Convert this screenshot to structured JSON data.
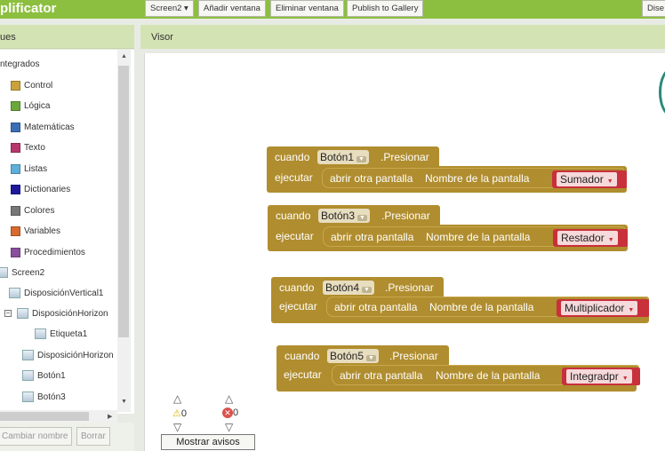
{
  "topbar": {
    "app_title": "plificator",
    "buttons": [
      "Screen2 ▾",
      "Añadir ventana",
      "Eliminar ventana",
      "Publish to Gallery",
      "Dise"
    ]
  },
  "left_panel": {
    "header": "ues",
    "tree": {
      "root": "ntegrados",
      "categories": [
        {
          "label": "Control",
          "color": "#c9a23b"
        },
        {
          "label": "Lógica",
          "color": "#6ba83c"
        },
        {
          "label": "Matemáticas",
          "color": "#3b6fb5"
        },
        {
          "label": "Texto",
          "color": "#b5386a"
        },
        {
          "label": "Listas",
          "color": "#5fb0d8"
        },
        {
          "label": "Dictionaries",
          "color": "#1e1a9c"
        },
        {
          "label": "Colores",
          "color": "#777777"
        },
        {
          "label": "Variables",
          "color": "#d76a2f"
        },
        {
          "label": "Procedimientos",
          "color": "#8a4f9c"
        }
      ],
      "screen": "Screen2",
      "components": [
        "DisposiciónVertical1",
        "DisposiciónHorizon",
        "Etiqueta1",
        "DisposiciónHorizon",
        "Botón1",
        "Botón3"
      ],
      "collapse_symbol": "−"
    },
    "footer": {
      "rename": "Cambiar nombre",
      "delete": "Borrar"
    }
  },
  "viewer": {
    "header": "Visor",
    "blocks": [
      {
        "when": "cuando",
        "component": "Botón1",
        "event": ".Presionar",
        "do": "ejecutar",
        "action": "abrir otra pantalla",
        "param": "Nombre de la pantalla",
        "value": "Sumador"
      },
      {
        "when": "cuando",
        "component": "Botón3",
        "event": ".Presionar",
        "do": "ejecutar",
        "action": "abrir otra pantalla",
        "param": "Nombre de la pantalla",
        "value": "Restador"
      },
      {
        "when": "cuando",
        "component": "Botón4",
        "event": ".Presionar",
        "do": "ejecutar",
        "action": "abrir otra pantalla",
        "param": "Nombre de la pantalla",
        "value": "Multiplicador"
      },
      {
        "when": "cuando",
        "component": "Botón5",
        "event": ".Presionar",
        "do": "ejecutar",
        "action": "abrir otra pantalla",
        "param": "Nombre de la pantalla",
        "value": "Integradpr"
      }
    ],
    "warnings": {
      "count": "0",
      "errors": "0",
      "show_button": "Mostrar avisos"
    }
  },
  "colors": {
    "topbar": "#8cbf3f",
    "event_block": "#b08d2e",
    "text_block": "#c8303b"
  }
}
